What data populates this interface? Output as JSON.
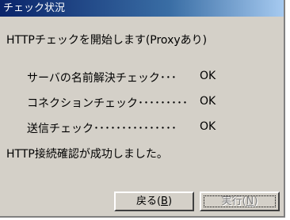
{
  "window": {
    "title": "チェック状況"
  },
  "messages": {
    "start": "HTTPチェックを開始します(Proxyあり)",
    "result": "HTTP接続確認が成功しました。"
  },
  "checks": [
    {
      "label": "サーバの名前解決チェック･･･",
      "status": "OK"
    },
    {
      "label": "コネクションチェック･････････",
      "status": "OK"
    },
    {
      "label": "送信チェック･･･････････････",
      "status": "OK"
    }
  ],
  "buttons": {
    "back": {
      "label": "戻る(",
      "mnemonic": "B",
      "suffix": ")"
    },
    "run": {
      "label": "実行(",
      "mnemonic": "N",
      "suffix": ")",
      "disabled": true
    }
  }
}
